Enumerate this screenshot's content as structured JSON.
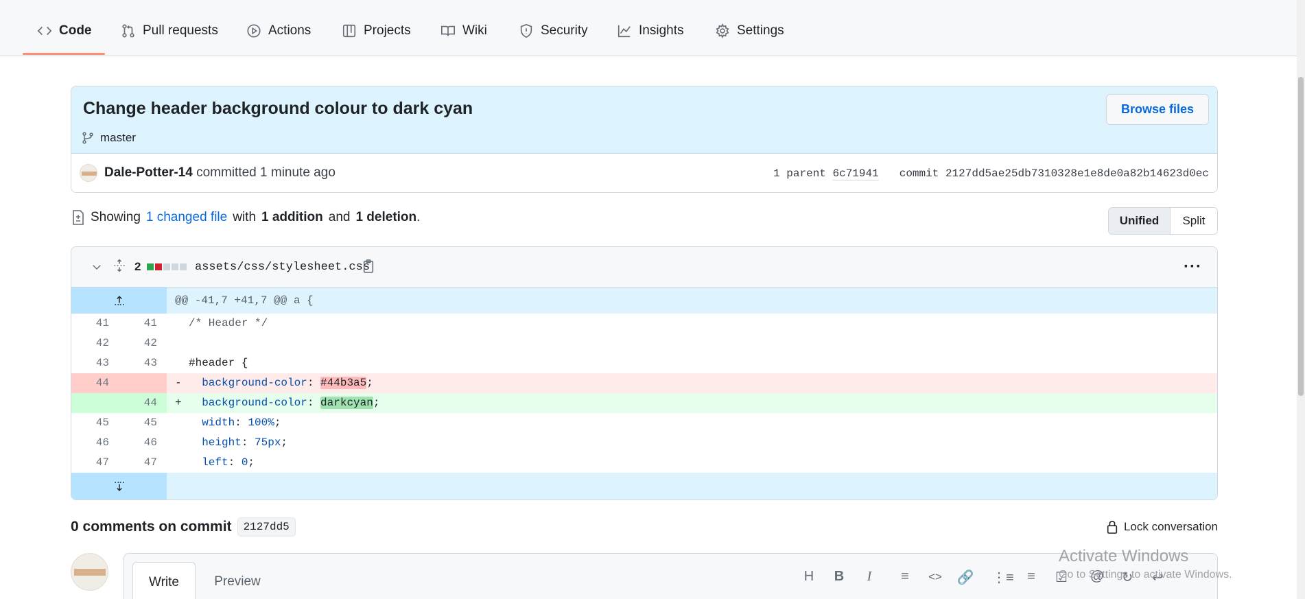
{
  "nav": {
    "tabs": [
      {
        "label": "Code",
        "icon": "code-icon"
      },
      {
        "label": "Pull requests",
        "icon": "pull-request-icon"
      },
      {
        "label": "Actions",
        "icon": "play-icon"
      },
      {
        "label": "Projects",
        "icon": "table-icon"
      },
      {
        "label": "Wiki",
        "icon": "book-icon"
      },
      {
        "label": "Security",
        "icon": "shield-icon"
      },
      {
        "label": "Insights",
        "icon": "graph-icon"
      },
      {
        "label": "Settings",
        "icon": "gear-icon"
      }
    ],
    "active": "Code"
  },
  "commit": {
    "title": "Change header background colour to dark cyan",
    "branch": "master",
    "browse_label": "Browse files",
    "author": "Dale-Potter-14",
    "action": "committed",
    "time": "1 minute ago",
    "parent_label": "1 parent",
    "parent_sha": "6c71941",
    "commit_label": "commit",
    "commit_sha": "2127dd5ae25db7310328e1e8de0a82b14623d0ec"
  },
  "summary": {
    "prefix": "Showing",
    "changed": "1 changed file",
    "with": "with",
    "additions": "1 addition",
    "and": "and",
    "deletions": "1 deletion",
    "suffix": ".",
    "view_unified": "Unified",
    "view_split": "Split"
  },
  "file": {
    "changes": "2",
    "path": "assets/css/stylesheet.css",
    "hunk": "@@ -41,7 +41,7 @@ a {",
    "lines": [
      {
        "type": "ctx",
        "old": "41",
        "new": "41",
        "marker": " ",
        "text": "/* Header */"
      },
      {
        "type": "ctx",
        "old": "42",
        "new": "42",
        "marker": " ",
        "text": ""
      },
      {
        "type": "ctx",
        "old": "43",
        "new": "43",
        "marker": " ",
        "text": "#header {"
      },
      {
        "type": "del",
        "old": "44",
        "new": "",
        "marker": "-",
        "prop": "background-color",
        "value": "#44b3a5"
      },
      {
        "type": "add",
        "old": "",
        "new": "44",
        "marker": "+",
        "prop": "background-color",
        "value": "darkcyan"
      },
      {
        "type": "ctx",
        "old": "45",
        "new": "45",
        "marker": " ",
        "prop": "width",
        "value": "100%"
      },
      {
        "type": "ctx",
        "old": "46",
        "new": "46",
        "marker": " ",
        "prop": "height",
        "value": "75px"
      },
      {
        "type": "ctx",
        "old": "47",
        "new": "47",
        "marker": " ",
        "prop": "left",
        "value": "0"
      }
    ]
  },
  "comments": {
    "title": "0 comments on commit",
    "sha": "2127dd5",
    "lock_label": "Lock conversation",
    "tab_write": "Write",
    "tab_preview": "Preview",
    "toolbar": [
      "H",
      "B",
      "I",
      "quote",
      "<>",
      "link",
      "ul",
      "ol",
      "task",
      "@",
      "ref",
      "reply"
    ]
  },
  "watermark": {
    "line1": "Activate Windows",
    "line2": "Go to Settings to activate Windows."
  },
  "colors": {
    "accent": "#0969da",
    "tab_underline": "#fd8c73",
    "added": "#2da44e",
    "deleted": "#cf222e"
  }
}
